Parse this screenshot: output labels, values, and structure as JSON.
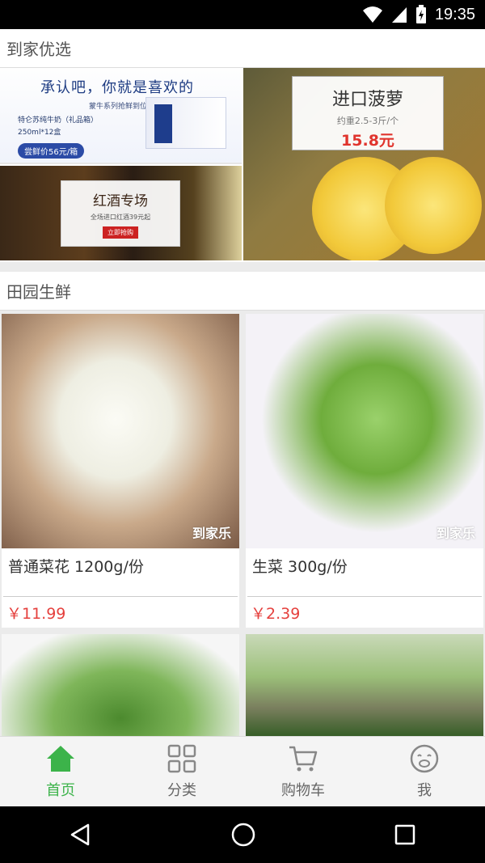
{
  "status_bar": {
    "time": "19:35"
  },
  "section_featured": {
    "title": "到家优选"
  },
  "promos": {
    "milk": {
      "slogan": "承认吧，你就是喜欢的",
      "subtitle": "蒙牛系列抢鲜到位",
      "product_name": "特仑苏纯牛奶（礼品箱）",
      "spec": "250ml*12盒",
      "price_label": "尝鲜价56元/箱"
    },
    "wine": {
      "title": "红酒专场",
      "subtitle": "全场进口红酒39元起",
      "button": "立即抢购"
    },
    "pineapple": {
      "title": "进口菠萝",
      "weight": "约重2.5-3斤/个",
      "price": "15.8元"
    }
  },
  "section_fresh": {
    "title": "田园生鲜"
  },
  "products": [
    {
      "name": "普通菜花 1200g/份",
      "price": "￥11.99",
      "watermark": "到家乐"
    },
    {
      "name": "生菜 300g/份",
      "price": "￥2.39",
      "watermark": "到家乐"
    }
  ],
  "bottom_nav": {
    "items": [
      {
        "label": "首页",
        "icon": "home-icon",
        "active": true
      },
      {
        "label": "分类",
        "icon": "grid-icon",
        "active": false
      },
      {
        "label": "购物车",
        "icon": "cart-icon",
        "active": false
      },
      {
        "label": "我",
        "icon": "face-icon",
        "active": false
      }
    ]
  },
  "colors": {
    "accent": "#3cb34a",
    "price": "#e5403d"
  }
}
